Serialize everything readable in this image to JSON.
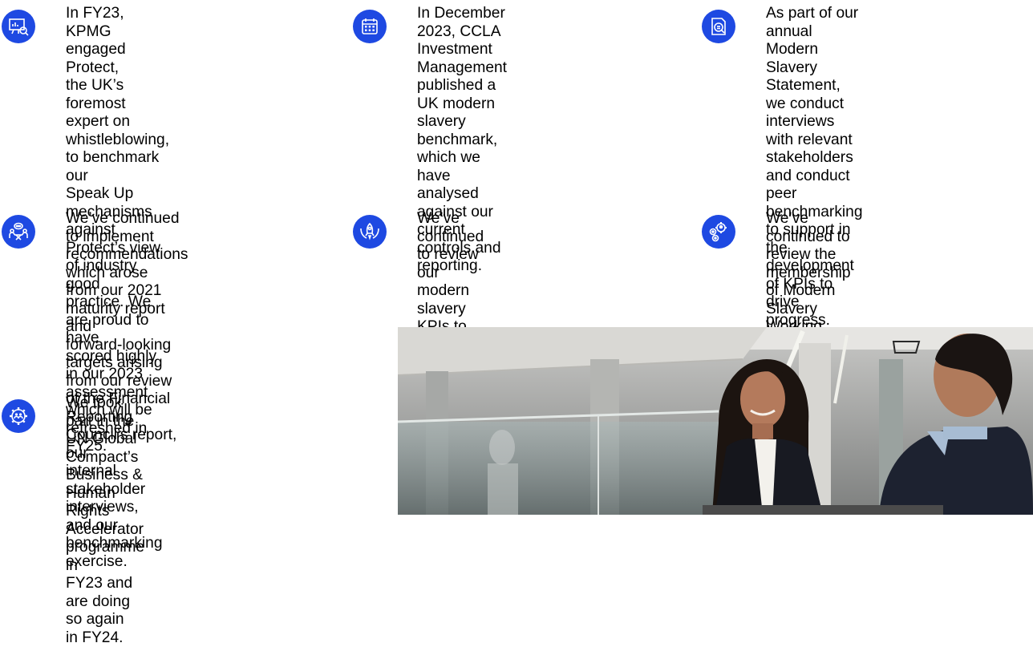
{
  "items": [
    {
      "icon": "presentation-search-icon",
      "text": "In FY23, KPMG engaged Protect,\nthe UK’s foremost expert on\nwhistleblowing, to benchmark our\nSpeak Up mechanisms against\nProtect’s view of industry good\npractice. We are proud to have\nscored highly in our 2023\nassessment which will be\nrefreshed in FY25."
    },
    {
      "icon": "calendar-icon",
      "text": "In December 2023, CCLA\nInvestment Management\npublished a UK modern slavery\nbenchmark, which we have\nanalysed against our current\ncontrols and reporting."
    },
    {
      "icon": "document-search-icon",
      "text": "As part of our annual Modern\nSlavery Statement, we conduct\ninterviews with relevant\nstakeholders and conduct peer\nbenchmarking to support in the\ndevelopment of KPIs to drive\nprogress."
    },
    {
      "icon": "meeting-chat-icon",
      "text": "We’ve continued to implement\nrecommendations which arose\nfrom our 2021 maturity report and\nforward-looking targets arising\nfrom our review of the Financial\nReporting Council’s report, our\ninternal stakeholder interviews,\nand our benchmarking exercise."
    },
    {
      "icon": "rocket-hands-icon",
      "text": "We’ve continued to review our\nmodern slavery KPIs to track and\ndrive progress effectively."
    },
    {
      "icon": "people-gear-icon",
      "text": "We’ve continued to review the\nmembership of Modern Slavery\nWorking Group and add additional\nmembers as required."
    },
    {
      "icon": "group-gear-icon",
      "text": "We took part in the UN Global\nCompact’s Business & Human\nRights Accelerator programme in\nFY23 and are doing so again\nin FY24."
    }
  ],
  "colors": {
    "accent": "#1e49e2",
    "text": "#000000"
  }
}
